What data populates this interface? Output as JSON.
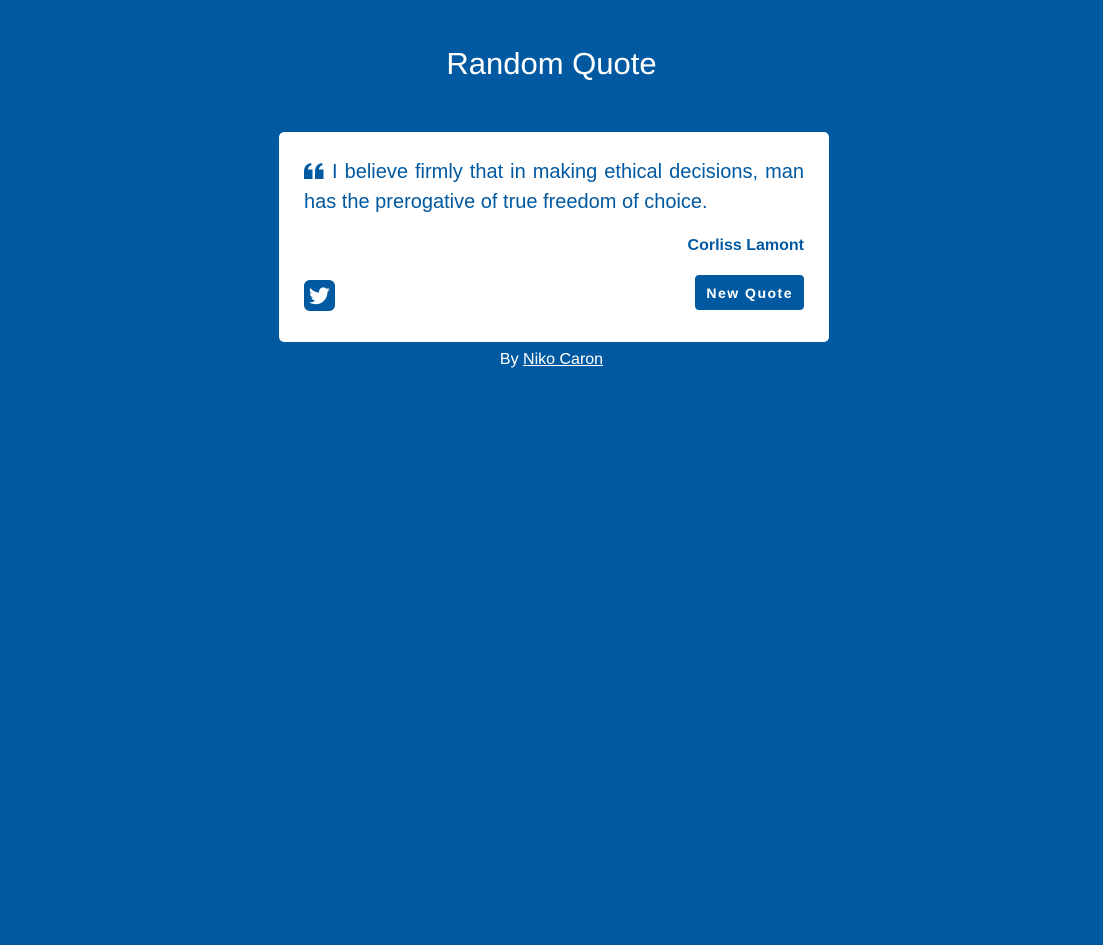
{
  "header": {
    "title": "Random Quote"
  },
  "quote": {
    "text": "I believe firmly that in making ethical decisions, man has the prerogative of true freedom of choice.",
    "author": "Corliss Lamont",
    "icon": "quote-left-icon"
  },
  "actions": {
    "tweet_icon": "twitter-icon",
    "new_quote_label": "New Quote"
  },
  "footer": {
    "prefix": "By",
    "author_link": "Niko Caron"
  },
  "colors": {
    "background": "#0059a1",
    "card": "#ffffff",
    "accent": "#0059a1"
  }
}
